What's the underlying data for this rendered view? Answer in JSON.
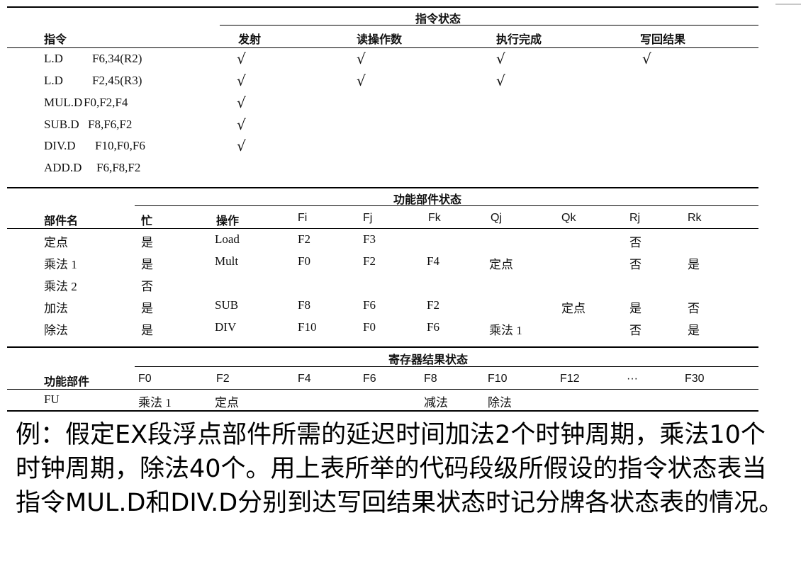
{
  "table1": {
    "group_title": "指令状态",
    "headers": {
      "instr": "指令",
      "issue": "发射",
      "read": "读操作数",
      "exec": "执行完成",
      "write": "写回结果"
    },
    "rows": [
      {
        "op": "L.D",
        "args": "F6,34(R2)",
        "issue": "√",
        "read": "√",
        "exec": "√",
        "write": "√"
      },
      {
        "op": "L.D",
        "args": "F2,45(R3)",
        "issue": "√",
        "read": "√",
        "exec": "√",
        "write": ""
      },
      {
        "op": "MUL.D",
        "args": "F0,F2,F4",
        "issue": "√",
        "read": "",
        "exec": "",
        "write": ""
      },
      {
        "op": "SUB.D",
        "args": "F8,F6,F2",
        "issue": "√",
        "read": "",
        "exec": "",
        "write": ""
      },
      {
        "op": "DIV.D",
        "args": "F10,F0,F6",
        "issue": "√",
        "read": "",
        "exec": "",
        "write": ""
      },
      {
        "op": "ADD.D",
        "args": "F6,F8,F2",
        "issue": "",
        "read": "",
        "exec": "",
        "write": ""
      }
    ]
  },
  "table2": {
    "group_title": "功能部件状态",
    "headers": [
      "部件名",
      "忙",
      "操作",
      "Fi",
      "Fj",
      "Fk",
      "Qj",
      "Qk",
      "Rj",
      "Rk"
    ],
    "rows": [
      [
        "定点",
        "是",
        "Load",
        "F2",
        "F3",
        "",
        "",
        "",
        "否",
        ""
      ],
      [
        "乘法 1",
        "是",
        "Mult",
        "F0",
        "F2",
        "F4",
        "定点",
        "",
        "否",
        "是"
      ],
      [
        "乘法 2",
        "否",
        "",
        "",
        "",
        "",
        "",
        "",
        "",
        ""
      ],
      [
        "加法",
        "是",
        "SUB",
        "F8",
        "F6",
        "F2",
        "",
        "定点",
        "是",
        "否"
      ],
      [
        "除法",
        "是",
        "DIV",
        "F10",
        "F0",
        "F6",
        "乘法 1",
        "",
        "否",
        "是"
      ]
    ]
  },
  "table3": {
    "group_title": "寄存器结果状态",
    "headers": [
      "功能部件",
      "F0",
      "F2",
      "F4",
      "F6",
      "F8",
      "F10",
      "F12",
      "···",
      "F30"
    ],
    "row": [
      "FU",
      "乘法 1",
      "定点",
      "",
      "",
      "减法",
      "除法",
      "",
      "",
      ""
    ]
  },
  "note": "例：假定EX段浮点部件所需的延迟时间加法2个时钟周期，乘法10个时钟周期，除法40个。用上表所举的代码段级所假设的指令状态表当指令MUL.D和DIV.D分别到达写回结果状态时记分牌各状态表的情况。"
}
